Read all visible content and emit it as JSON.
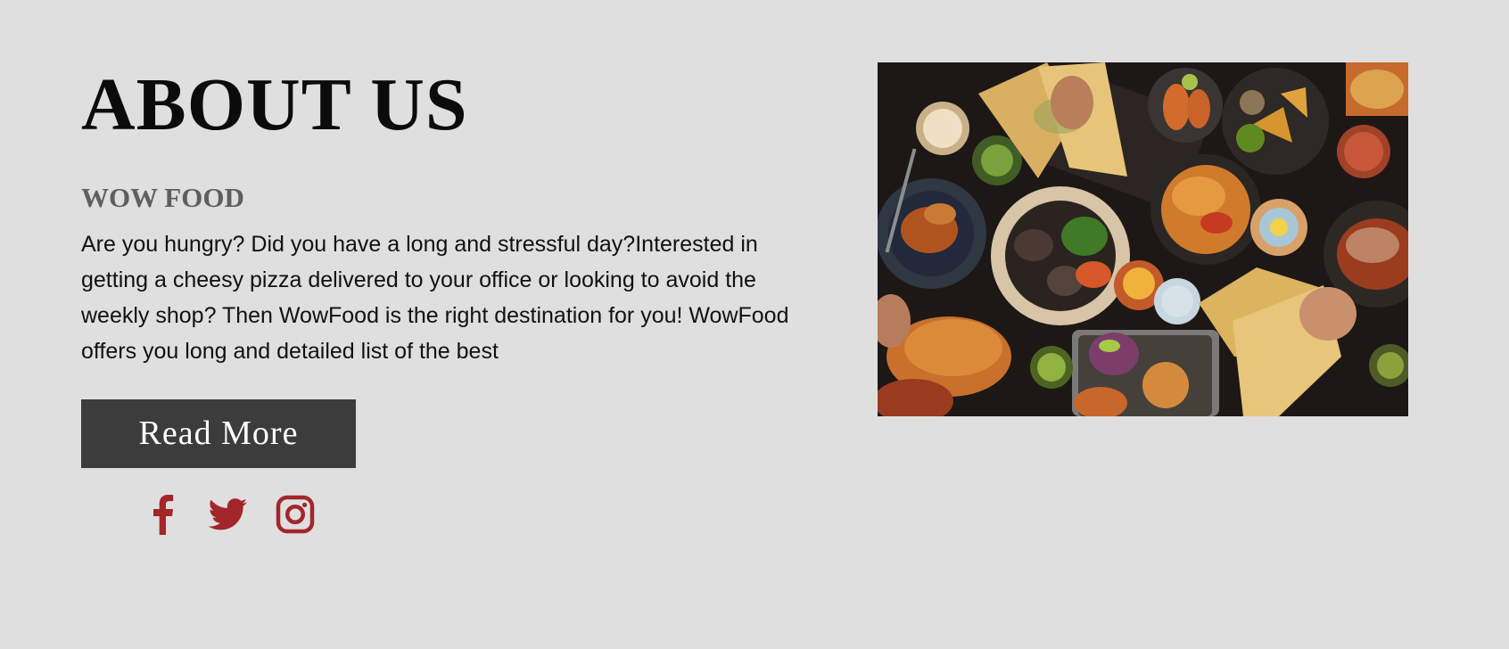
{
  "about": {
    "title": "ABOUT US",
    "brand": "WOW FOOD",
    "description": "Are you hungry? Did you have a long and stressful day?Interested in getting a cheesy pizza delivered to your office or looking to avoid the weekly shop? Then WowFood is the right destination for you! WowFood offers you long and detailed list of the best",
    "read_more_label": "Read More"
  },
  "social": {
    "icons": [
      "facebook-icon",
      "twitter-icon",
      "instagram-icon"
    ],
    "icon_color": "#a3262a"
  },
  "colors": {
    "background": "#dfdfdf",
    "button_background": "#3c3c3c",
    "button_text": "#ffffff",
    "brand_text": "#5f5f5f",
    "accent": "#a3262a"
  }
}
